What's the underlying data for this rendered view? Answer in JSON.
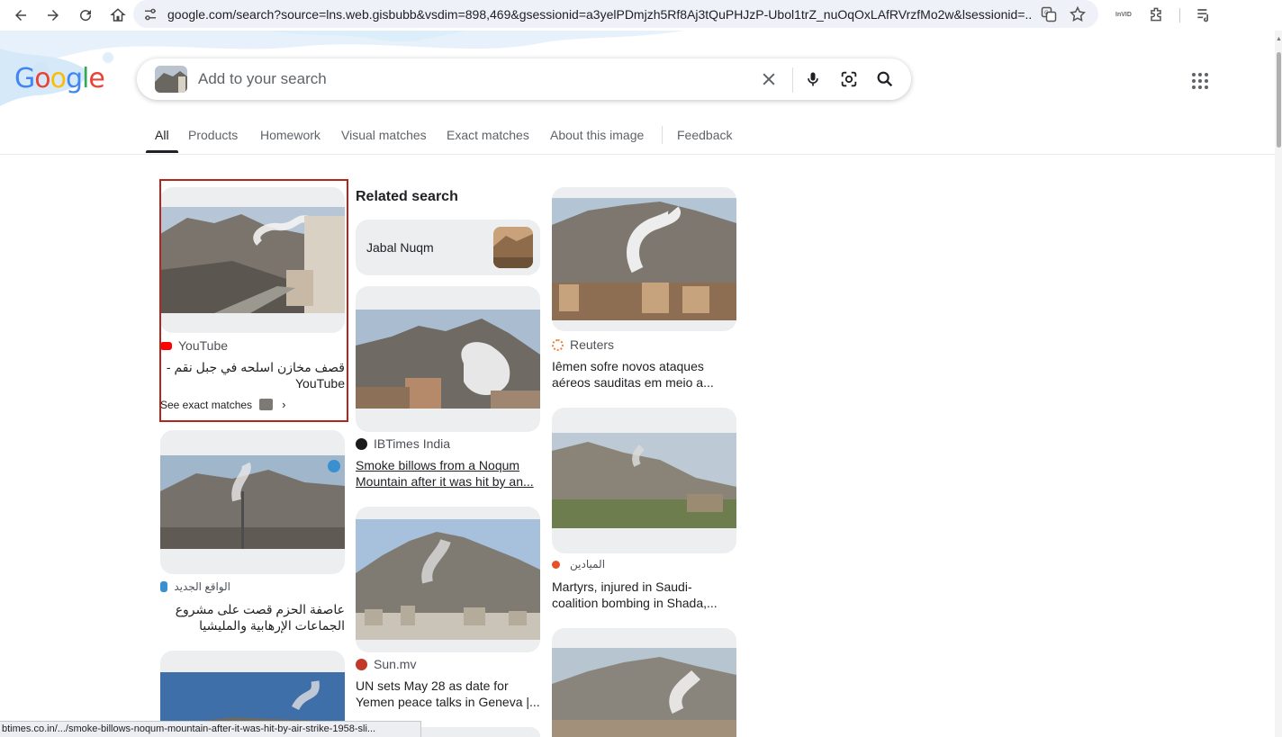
{
  "browser": {
    "url": "google.com/search?source=lns.web.gisbubb&vsdim=898,469&gsessionid=a3yelPDmjzh5Rf8Aj3tQuPHJzP-Ubol1trZ_nuOqOxLAfRVrzfMo2w&lsessionid=...",
    "extension_label": "InVID"
  },
  "header": {
    "logo": "Google",
    "search_placeholder": "Add to your search"
  },
  "tabs": [
    "All",
    "Products",
    "Homework",
    "Visual matches",
    "Exact matches",
    "About this image",
    "Feedback"
  ],
  "results": {
    "col1": [
      {
        "source": "YouTube",
        "title": "قصف مخازن اسلحه في جبل نقم - YouTube",
        "see_exact": "See exact matches"
      },
      {
        "source": "الواقع الجديد",
        "title": "عاصفة الحزم قصت على مشروع الجماعات الإرهابية والمليشيا الانقلابية في أبين – الواقع"
      }
    ],
    "related": {
      "heading": "Related search",
      "chip_label": "Jabal Nuqm"
    },
    "col2": [
      {
        "source": "IBTimes India",
        "title": "Smoke billows from a Noqum Mountain after it was hit by an..."
      },
      {
        "source": "Sun.mv",
        "title": "UN sets May 28 as date for Yemen peace talks in Geneva |..."
      }
    ],
    "col3": [
      {
        "source": "Reuters",
        "title": "Iêmen sofre novos ataques aéreos sauditas em meio a..."
      },
      {
        "source": "الميادين",
        "title": "Martyrs, injured in Saudi-coalition bombing in Shada,..."
      }
    ]
  },
  "status_bar": "btimes.co.in/.../smoke-billows-noqum-mountain-after-it-was-hit-by-air-strike-1958-sli...",
  "colors": {
    "youtube_red": "#ff0000",
    "highlight_border": "#b3261e",
    "reuters_orange": "#f0833a",
    "mayadeen_orange": "#e8502a"
  }
}
